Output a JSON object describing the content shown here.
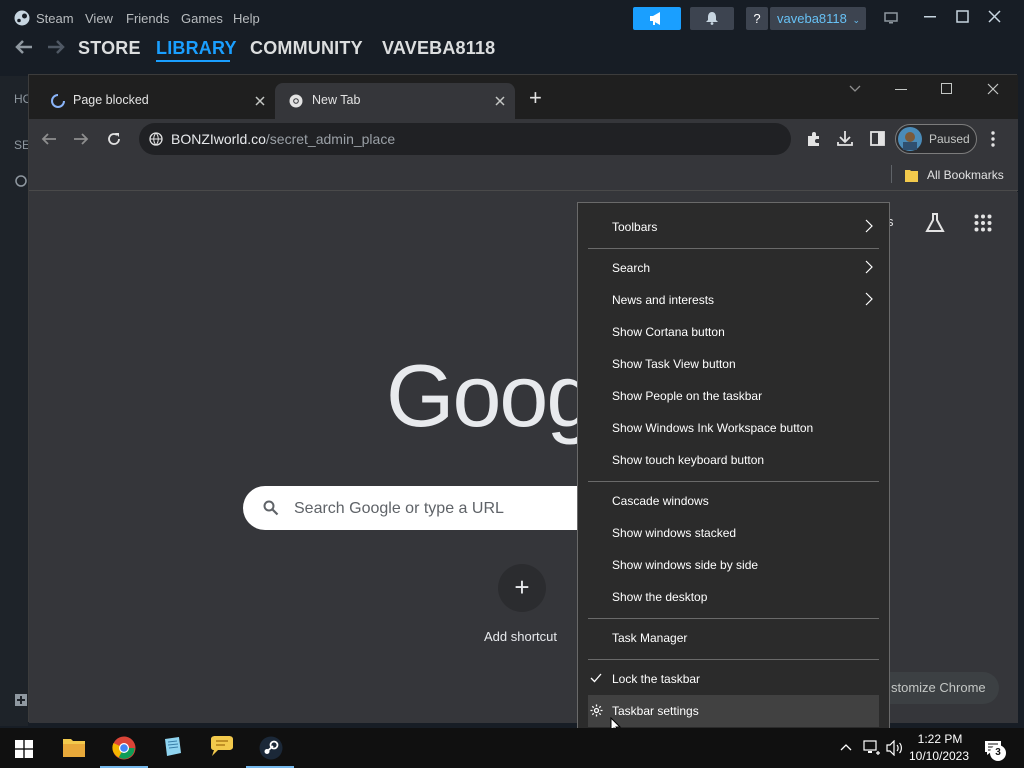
{
  "steam": {
    "menu": [
      "Steam",
      "View",
      "Friends",
      "Games",
      "Help"
    ],
    "nav": {
      "store": "STORE",
      "library": "LIBRARY",
      "community": "COMMUNITY",
      "user": "VAVEBA8118"
    },
    "help_label": "?",
    "username": "vaveba8118",
    "left_partial": {
      "home": "HO",
      "search": "SE"
    },
    "accent": "#1a9fff"
  },
  "chrome": {
    "tabs": [
      {
        "label": "Page blocked",
        "active": false
      },
      {
        "label": "New Tab",
        "active": true
      }
    ],
    "new_tab_label": "+",
    "omnibox": {
      "host": "BONZIworld.co",
      "path": "/secret_admin_place"
    },
    "profile_status": "Paused",
    "bookmarks": {
      "all_label": "All Bookmarks"
    },
    "ntp": {
      "logo_text": "Goog",
      "search_placeholder": "Search Google or type a URL",
      "add_shortcut_label": "Add shortcut",
      "customize_label": "stomize Chrome",
      "topright_partial": "s"
    }
  },
  "context_menu": {
    "group1": [
      {
        "label": "Toolbars",
        "submenu": true
      }
    ],
    "group2": [
      {
        "label": "Search",
        "submenu": true
      },
      {
        "label": "News and interests",
        "submenu": true
      },
      {
        "label": "Show Cortana button",
        "submenu": false
      },
      {
        "label": "Show Task View button",
        "submenu": false
      },
      {
        "label": "Show People on the taskbar",
        "submenu": false
      },
      {
        "label": "Show Windows Ink Workspace button",
        "submenu": false
      },
      {
        "label": "Show touch keyboard button",
        "submenu": false
      }
    ],
    "group3": [
      {
        "label": "Cascade windows"
      },
      {
        "label": "Show windows stacked"
      },
      {
        "label": "Show windows side by side"
      },
      {
        "label": "Show the desktop"
      }
    ],
    "group4": [
      {
        "label": "Task Manager"
      }
    ],
    "group5": [
      {
        "label": "Lock the taskbar",
        "checked": true
      },
      {
        "label": "Taskbar settings",
        "icon": "gear-icon",
        "highlighted": true
      }
    ]
  },
  "taskbar": {
    "apps": [
      "start-icon",
      "file-explorer-icon",
      "chrome-icon",
      "notepad-icon",
      "chat-icon",
      "steam-icon"
    ],
    "time": "1:22 PM",
    "date": "10/10/2023",
    "notification_count": "3"
  }
}
